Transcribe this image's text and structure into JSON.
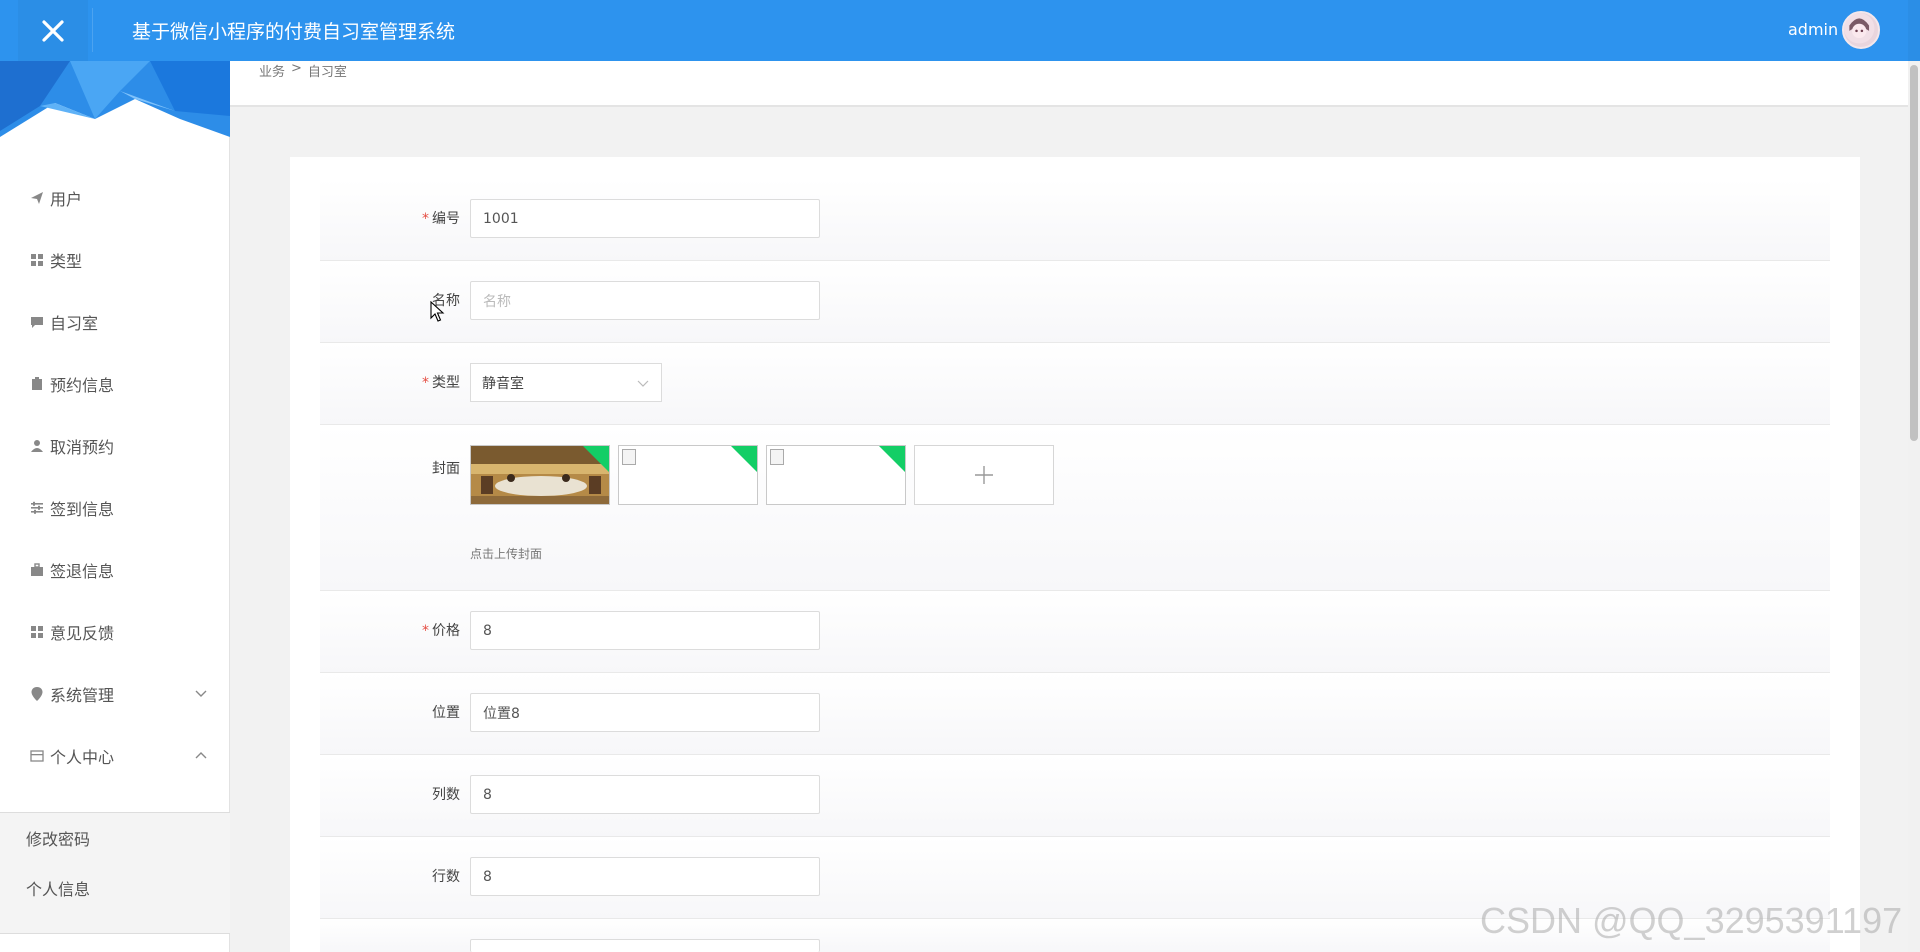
{
  "header": {
    "app_title": "基于微信小程序的付费自习室管理系统",
    "user_name": "admin",
    "close_icon": "close-icon",
    "avatar_icon": "avatar"
  },
  "sidebar": {
    "items": [
      {
        "label": "用户",
        "icon": "send-icon"
      },
      {
        "label": "类型",
        "icon": "grid-icon"
      },
      {
        "label": "自习室",
        "icon": "chat-icon"
      },
      {
        "label": "预约信息",
        "icon": "clipboard-icon"
      },
      {
        "label": "取消预约",
        "icon": "user-icon"
      },
      {
        "label": "签到信息",
        "icon": "sliders-icon"
      },
      {
        "label": "签退信息",
        "icon": "briefcase-icon"
      },
      {
        "label": "意见反馈",
        "icon": "grid-icon"
      },
      {
        "label": "系统管理",
        "icon": "pin-icon"
      },
      {
        "label": "个人中心",
        "icon": "card-icon"
      }
    ],
    "sub_items": [
      {
        "label": "修改密码"
      },
      {
        "label": "个人信息"
      }
    ]
  },
  "breadcrumb": {
    "parent": "业务",
    "separator": ">",
    "current": "自习室"
  },
  "form": {
    "fields": [
      {
        "label": "编号",
        "required": true,
        "value": "1001",
        "placeholder": ""
      },
      {
        "label": "名称",
        "required": false,
        "value": "",
        "placeholder": "名称"
      },
      {
        "label": "类型",
        "required": true,
        "value": "静音室"
      },
      {
        "label": "封面",
        "required": false,
        "hint": "点击上传封面"
      },
      {
        "label": "价格",
        "required": true,
        "value": "8"
      },
      {
        "label": "位置",
        "required": false,
        "value": "位置8"
      },
      {
        "label": "列数",
        "required": false,
        "value": "8"
      },
      {
        "label": "行数",
        "required": false,
        "value": "8"
      }
    ],
    "required_mark": "*",
    "upload_plus": "+"
  },
  "watermark": "CSDN @QQ_3295391197",
  "colors": {
    "header_bg": "#2d93ee",
    "success_corner": "#13ce66",
    "required": "#e54d42"
  }
}
